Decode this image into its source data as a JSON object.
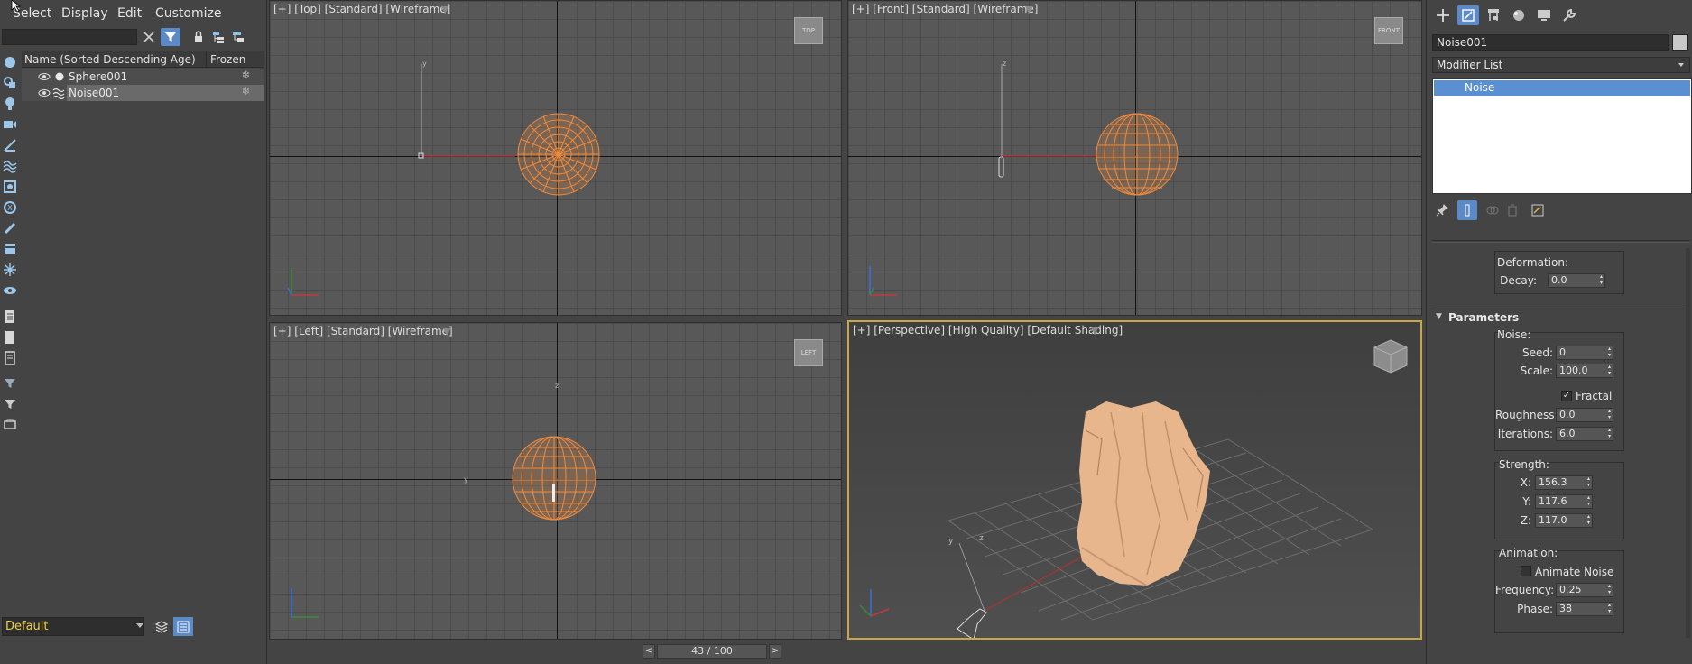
{
  "menubar": {
    "items": [
      "Select",
      "Display",
      "Edit",
      "Customize"
    ]
  },
  "explorer": {
    "search": {
      "value": "",
      "placeholder": ""
    },
    "columns": {
      "name": "Name (Sorted Descending Age)",
      "frozen": "Frozen"
    },
    "rows": [
      {
        "name": "Sphere001",
        "frozen": "❄",
        "selected": false
      },
      {
        "name": "Noise001",
        "frozen": "❄",
        "selected": true
      }
    ],
    "layer": "Default"
  },
  "viewports": {
    "top": {
      "label": "[+] [Top] [Standard] [Wireframe]",
      "cube": "TOP"
    },
    "front": {
      "label": "[+] [Front] [Standard] [Wireframe]",
      "cube": "FRONT"
    },
    "left": {
      "label": "[+] [Left] [Standard] [Wireframe]",
      "cube": "LEFT"
    },
    "perspective": {
      "label": "[+] [Perspective] [High Quality] [Default Shading]"
    }
  },
  "timeline": {
    "frame": "43 / 100",
    "prev": "<",
    "next": ">"
  },
  "command_panel": {
    "object_name": "Noise001",
    "modifier_list": "Modifier List",
    "stack": [
      "Noise"
    ],
    "deformation": {
      "title": "Deformation:",
      "decay_label": "Decay:",
      "decay": "0.0"
    },
    "parameters": {
      "title": "Parameters",
      "noise_title": "Noise:",
      "seed_label": "Seed:",
      "seed": "0",
      "scale_label": "Scale:",
      "scale": "100.0",
      "fractal_label": "Fractal",
      "fractal": true,
      "roughness_label": "Roughness:",
      "roughness": "0.0",
      "iterations_label": "Iterations:",
      "iterations": "6.0",
      "strength_title": "Strength:",
      "x_label": "X:",
      "x": "156.3",
      "y_label": "Y:",
      "y": "117.6",
      "z_label": "Z:",
      "z": "117.0",
      "animation_title": "Animation:",
      "animate_label": "Animate Noise",
      "animate": false,
      "frequency_label": "Frequency:",
      "frequency": "0.25",
      "phase_label": "Phase:",
      "phase": "38"
    }
  },
  "colors": {
    "accent": "#5a8fd1",
    "wireframe": "#f08a3c",
    "mesh": "#e9b890",
    "active_viewport": "#c9a64a",
    "layer_text": "#f0d04a"
  }
}
